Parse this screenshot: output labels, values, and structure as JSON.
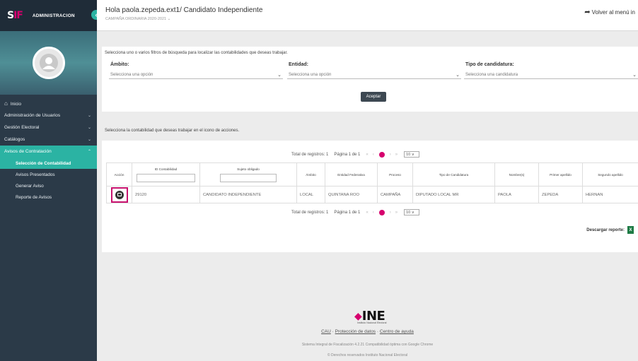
{
  "sidebar": {
    "logo_main": "S",
    "logo_accent": "IF",
    "title": "ADMINISTRACION",
    "toggle_icon": "‹",
    "menu": [
      {
        "label": "Inicio",
        "icon": "home-icon",
        "chevron": ""
      },
      {
        "label": "Administración de Usuarios",
        "chevron": "⌄"
      },
      {
        "label": "Gestión Electoral",
        "chevron": "⌄"
      },
      {
        "label": "Catálogos",
        "chevron": "⌄"
      },
      {
        "label": "Avisos de Contratación",
        "chevron": "⌃"
      }
    ],
    "submenu": [
      {
        "label": "Selección de Contabilidad"
      },
      {
        "label": "Avisos Presentados"
      },
      {
        "label": "Generar Aviso"
      },
      {
        "label": "Reporte de Avisos"
      }
    ]
  },
  "topbar": {
    "title": "Hola paola.zepeda.ext1/ Candidato Independiente",
    "subtitle": "CAMPAÑA ORDINARIA 2020-2021 ⌄",
    "back": "Volver al menú in"
  },
  "filters": {
    "instruction": "Selecciona uno o varios filtros de búsqueda para localizar las contabilidades que deseas trabajar.",
    "ambito_label": "Ámbito:",
    "ambito_placeholder": "Selecciona una opción",
    "entidad_label": "Entidad:",
    "entidad_placeholder": "Selecciona una opción",
    "tipo_label": "Tipo de candidatura:",
    "tipo_placeholder": "Selecciona una candidatura",
    "accept": "Aceptar"
  },
  "table_section": {
    "instruction": "Selecciona la contabilidad que deseas trabajar en el icono de acciones.",
    "pager_top": {
      "total": "Total de registros: 1",
      "page": "Página 1 de 1",
      "size": "10 ∨"
    },
    "pager_bottom": {
      "total": "Total de registros: 1",
      "page": "Página 1 de 1",
      "size": "10 ∨"
    },
    "columns": [
      "Acción",
      "ID Contabilidad",
      "Sujeto obligado",
      "Ámbito",
      "Entidad Federativa",
      "Proceso",
      "Tipo de Candidatura",
      "Nombre(s)",
      "Primer apellido",
      "Segundo apellido"
    ],
    "rows": [
      [
        "",
        "29120",
        "CANDIDATO INDEPENDIENTE",
        "LOCAL",
        "QUINTANA ROO",
        "CAMPAÑA",
        "DIPUTADO LOCAL MR",
        "PAOLA",
        "ZEPEDA",
        "HERNAN"
      ]
    ],
    "download": "Descargar reporte:",
    "download_icon": "excel-icon"
  },
  "footer": {
    "logo": "INE",
    "logo_sub": "Instituto Nacional Electoral",
    "link_cau": "CAU",
    "link_privacy": "Protección de datos",
    "link_help": "Centro de ayuda",
    "sep": " · ",
    "line1": "Sistema Integral de Fiscalización 4.2.21 Compatibilidad óptima con Google Chrome",
    "line2": "© Derechos reservados Instituto Nacional Electoral"
  },
  "colors": {
    "accent": "#2bb3a3",
    "brand": "#d6006e",
    "sidebar": "#2b3a48"
  }
}
